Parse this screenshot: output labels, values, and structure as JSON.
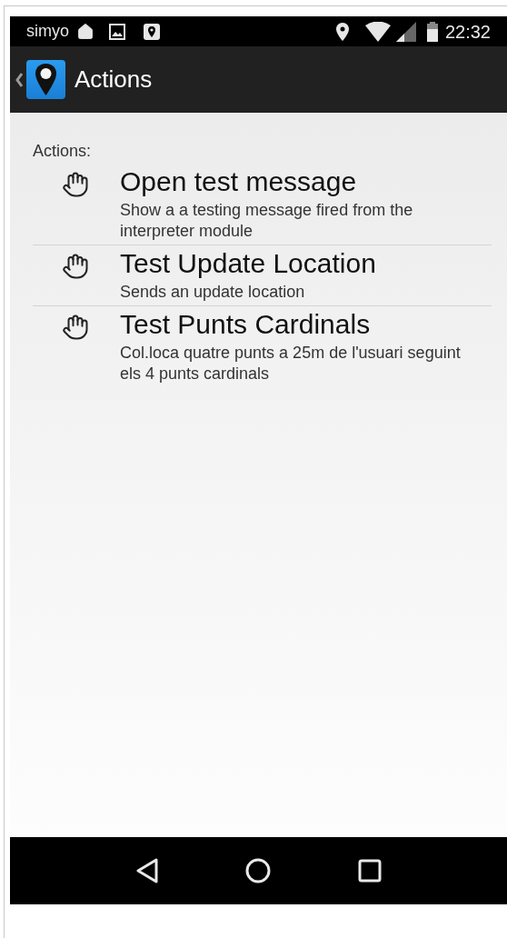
{
  "status_bar": {
    "carrier": "simyo",
    "time": "22:32"
  },
  "action_bar": {
    "title": "Actions"
  },
  "section_label": "Actions:",
  "actions": [
    {
      "title": "Open test message",
      "description": "Show a a testing message fired from the interpreter module"
    },
    {
      "title": "Test Update Location",
      "description": "Sends an update location"
    },
    {
      "title": "Test Punts Cardinals",
      "description": "Col.loca quatre punts a 25m de l'usuari seguint els 4 punts cardinals"
    }
  ]
}
